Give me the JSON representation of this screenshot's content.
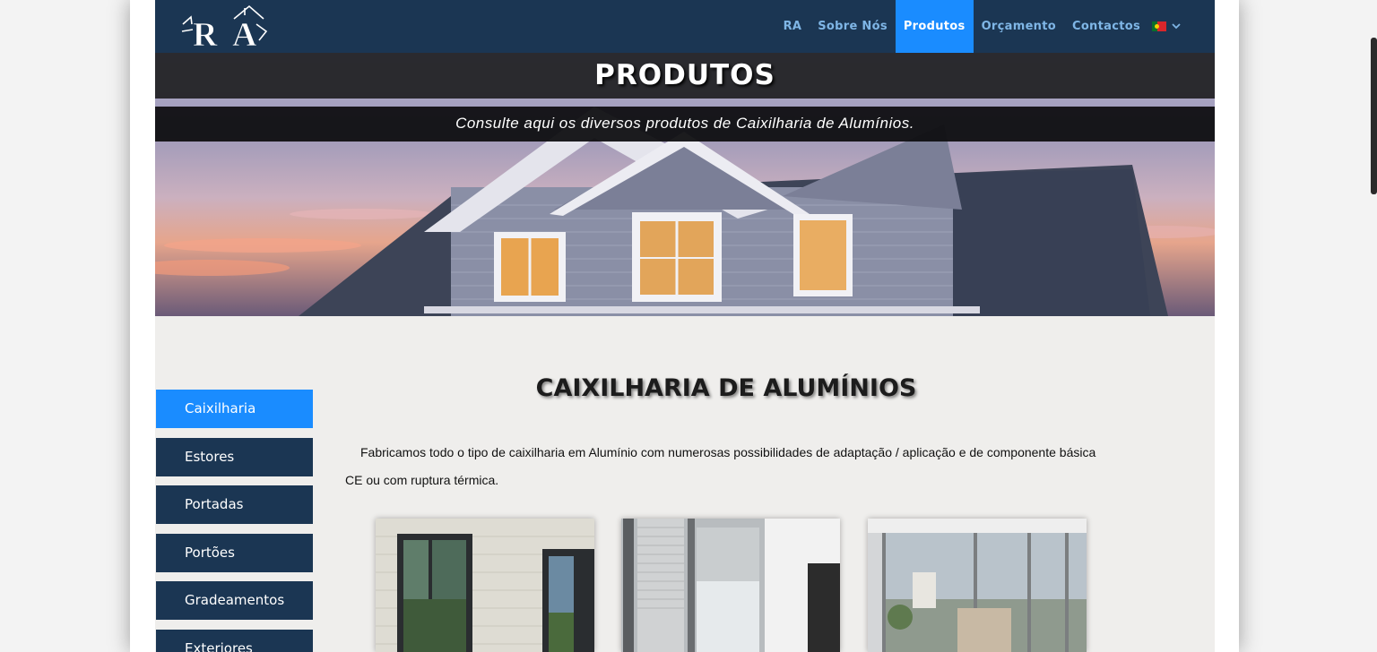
{
  "nav": {
    "logo_text": "RA",
    "items": [
      {
        "label": "RA",
        "active": false
      },
      {
        "label": "Sobre Nós",
        "active": false
      },
      {
        "label": "Produtos",
        "active": true
      },
      {
        "label": "Orçamento",
        "active": false
      },
      {
        "label": "Contactos",
        "active": false
      }
    ],
    "language_icon": "portugal-flag-icon",
    "dropdown_icon": "chevron-down-icon"
  },
  "hero": {
    "title": "PRODUTOS",
    "subtitle": "Consulte aqui os diversos produtos de Caixilharia de Alumínios."
  },
  "sidebar": {
    "items": [
      {
        "label": "Caixilharia",
        "active": true
      },
      {
        "label": "Estores",
        "active": false
      },
      {
        "label": "Portadas",
        "active": false
      },
      {
        "label": "Portões",
        "active": false
      },
      {
        "label": "Gradeamentos",
        "active": false
      },
      {
        "label": "Exteriores",
        "active": false
      }
    ]
  },
  "main": {
    "title": "CAIXILHARIA DE ALUMÍNIOS",
    "paragraph": "Fabricamos todo o tipo de caixilharia em Alumínio com numerosas possibilidades de adaptação / aplicação e de componente básica CE ou com ruptura térmica."
  },
  "colors": {
    "navbar": "#1b3653",
    "accent": "#1a8cff",
    "nav_text": "#7fb6e6"
  }
}
